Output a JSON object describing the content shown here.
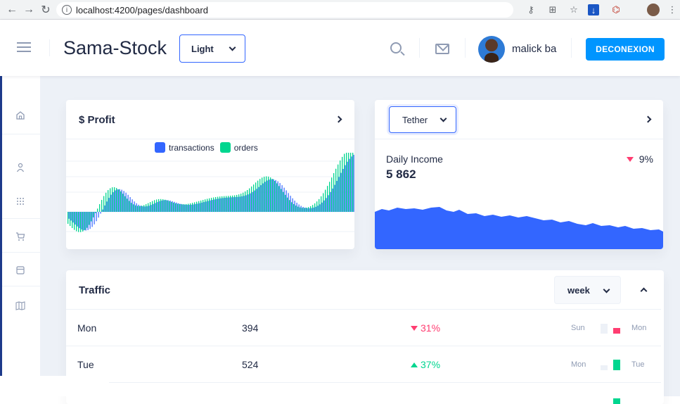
{
  "browser": {
    "url": "localhost:4200/pages/dashboard"
  },
  "header": {
    "brand": "Sama-Stock",
    "theme_select": "Light",
    "user_name": "malick ba",
    "logout_label": "DECONEXION"
  },
  "sidebar": {
    "items": [
      {
        "icon": "home-icon"
      },
      {
        "icon": "person-icon"
      },
      {
        "icon": "grid-icon"
      },
      {
        "icon": "cart-icon"
      },
      {
        "icon": "browser-icon"
      },
      {
        "icon": "map-icon"
      }
    ]
  },
  "profit_card": {
    "title": "$ Profit",
    "legend": [
      "transactions",
      "orders"
    ],
    "colors": {
      "transactions": "#3366ff",
      "orders": "#00d68f"
    }
  },
  "income_card": {
    "currency_select": "Tether",
    "label": "Daily Income",
    "value": "5 862",
    "delta": "9%",
    "delta_direction": "down",
    "area_color": "#3366ff"
  },
  "traffic_card": {
    "title": "Traffic",
    "period_select": "week",
    "rows": [
      {
        "day": "Mon",
        "value": "394",
        "delta": "31%",
        "direction": "down",
        "from": "Sun",
        "to": "Mon",
        "prev_level": 0.4,
        "cur_level": 0.4
      },
      {
        "day": "Tue",
        "value": "524",
        "delta": "37%",
        "direction": "up",
        "from": "Mon",
        "to": "Tue",
        "prev_level": 0.35,
        "cur_level": 0.75
      }
    ]
  }
}
